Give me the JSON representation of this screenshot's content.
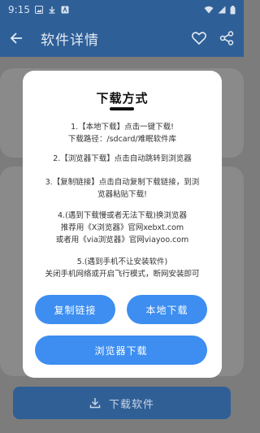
{
  "status": {
    "time": "9:15"
  },
  "appbar": {
    "title": "软件详情"
  },
  "dialog": {
    "heading": "下载方式",
    "paragraphs": [
      {
        "line1": "1.【本地下载】点击一键下载!",
        "line2": "下载路径：/sdcard/难眠软件库"
      },
      {
        "line1": "2.【浏览器下载】点击自动跳转到浏览器"
      },
      {
        "line1": "3.【复制链接】点击自动复制下载链接，到浏",
        "line2": "览器粘贴下载!"
      },
      {
        "line1": "4.(遇到下载慢或者无法下载)换浏览器",
        "line2": "推荐用《X浏览器》官网xebxt.com",
        "line3": "或者用《via浏览器》官网viayoo.com"
      },
      {
        "line1": "5.(遇到手机不让安装软件)",
        "line2": "关闭手机网络或开启飞行模式，断网安装即可"
      }
    ],
    "buttons": {
      "copy": "复制链接",
      "local": "本地下载",
      "browser": "浏览器下载"
    }
  },
  "download_bar": {
    "label": "下载软件"
  },
  "colors": {
    "primary": "#3d8ef0",
    "appbar_dimmed": "#2e5f97"
  }
}
